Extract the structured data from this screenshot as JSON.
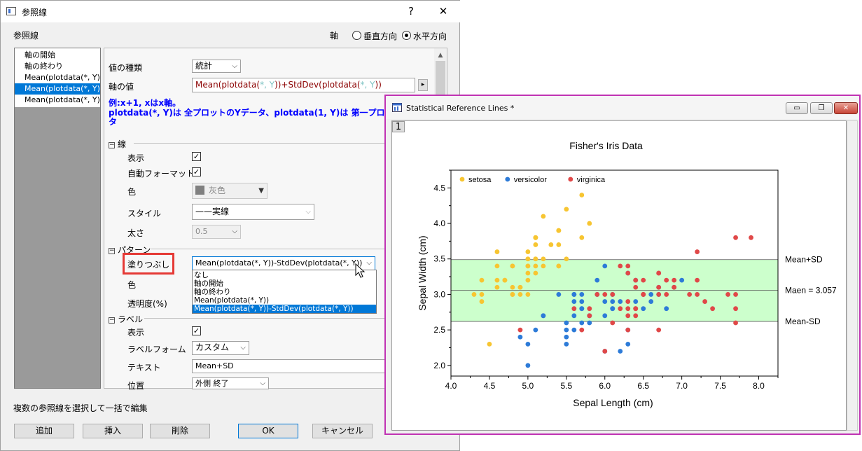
{
  "dialog": {
    "title": "参照線",
    "help_label": "?",
    "close_label": "✕",
    "section_label": "参照線",
    "axis_label": "軸",
    "axis_options": [
      "垂直方向",
      "水平方向"
    ],
    "axis_selected": 1,
    "tree_items": [
      "軸の開始",
      "軸の終わり",
      "Mean(plotdata(*, Y))",
      "Mean(plotdata(*, Y))",
      "Mean(plotdata(*, Y))"
    ],
    "tree_selected": 3,
    "value_type_label": "値の種類",
    "value_type_value": "統計",
    "axis_value_label": "軸の値",
    "axis_value_parts": [
      "Mean(plotdata(",
      "*, Y",
      "))+StdDev(plotdata(",
      "*, Y",
      "))"
    ],
    "expand_button_label": "▸",
    "hint_line1": "例:x+1, xはx軸。",
    "hint_line2": "plotdata(*, Y)は 全プロットのYデータ、plotdata(1, Y)は 第一プロッ",
    "hint_line3": "タ",
    "line_section": {
      "title": "線",
      "show_label": "表示",
      "auto_format_label": "自動フォーマット",
      "color_label": "色",
      "color_value": "灰色",
      "style_label": "スタイル",
      "style_value": "——実線",
      "width_label": "太さ",
      "width_value": "0.5"
    },
    "pattern_section": {
      "title": "パターン",
      "fill_label": "塗りつぶし",
      "fill_value": "Mean(plotdata(*, Y))-StdDev(plotdata(*, Y))",
      "color_label": "色",
      "transparency_label": "透明度(%)",
      "dropdown_options": [
        "なし",
        "軸の開始",
        "軸の終わり",
        "Mean(plotdata(*, Y))",
        "Mean(plotdata(*, Y))-StdDev(plotdata(*, Y))"
      ],
      "dropdown_selected": 4
    },
    "label_section": {
      "title": "ラベル",
      "show_label": "表示",
      "form_label": "ラベルフォーム",
      "form_value": "カスタム",
      "text_label": "テキスト",
      "text_value": "Mean+SD",
      "position_label": "位置",
      "position_value": "外側 終了"
    },
    "bulk_edit_label": "複数の参照線を選択して一括で編集",
    "buttons": {
      "add": "追加",
      "insert": "挿入",
      "delete": "削除",
      "ok": "OK",
      "cancel": "キャンセル"
    },
    "colors": {
      "selection": "#0078d7",
      "highlight_box": "#e53935",
      "hint_text": "#0000ff",
      "formula_text": "#8b0000"
    }
  },
  "graph_window": {
    "title": "Statistical Reference Lines *",
    "page_tab": "1",
    "buttons": [
      "▭",
      "❐",
      "✕"
    ],
    "colors": {
      "border": "#c033b3",
      "band_fill": "#ccffcc",
      "setosa": "#f7c531",
      "versicolor": "#2d7bd8",
      "virginica": "#e04848"
    }
  },
  "chart_data": {
    "type": "scatter",
    "title": "Fisher's Iris Data",
    "xlabel": "Sepal Length (cm)",
    "ylabel": "Sepal Width (cm)",
    "xlim": [
      4.0,
      8.25
    ],
    "ylim": [
      1.85,
      4.75
    ],
    "xticks": [
      "4.0",
      "4.5",
      "5.0",
      "5.5",
      "6.0",
      "6.5",
      "7.0",
      "7.5",
      "8.0"
    ],
    "yticks": [
      "2.0",
      "2.5",
      "3.0",
      "3.5",
      "4.0",
      "4.5"
    ],
    "legend": [
      "setosa",
      "versicolor",
      "virginica"
    ],
    "legend_position": "top-left",
    "grid": false,
    "reference_lines": [
      {
        "label": "Mean+SD",
        "y": 3.49
      },
      {
        "label": "Maen = 3.057",
        "y": 3.057
      },
      {
        "label": "Mean-SD",
        "y": 2.62
      }
    ],
    "band": [
      2.62,
      3.49
    ],
    "series": [
      {
        "name": "setosa",
        "points": [
          [
            5.1,
            3.5
          ],
          [
            4.9,
            3.0
          ],
          [
            4.7,
            3.2
          ],
          [
            4.6,
            3.1
          ],
          [
            5.0,
            3.6
          ],
          [
            5.4,
            3.9
          ],
          [
            4.6,
            3.4
          ],
          [
            5.0,
            3.4
          ],
          [
            4.4,
            2.9
          ],
          [
            4.9,
            3.1
          ],
          [
            5.4,
            3.7
          ],
          [
            4.8,
            3.4
          ],
          [
            4.8,
            3.0
          ],
          [
            4.3,
            3.0
          ],
          [
            5.8,
            4.0
          ],
          [
            5.7,
            4.4
          ],
          [
            5.4,
            3.9
          ],
          [
            5.1,
            3.5
          ],
          [
            5.7,
            3.8
          ],
          [
            5.1,
            3.8
          ],
          [
            5.4,
            3.4
          ],
          [
            5.1,
            3.7
          ],
          [
            4.6,
            3.6
          ],
          [
            5.1,
            3.3
          ],
          [
            4.8,
            3.4
          ],
          [
            5.0,
            3.0
          ],
          [
            5.0,
            3.4
          ],
          [
            5.2,
            3.5
          ],
          [
            5.2,
            3.4
          ],
          [
            4.7,
            3.2
          ],
          [
            4.8,
            3.1
          ],
          [
            5.4,
            3.4
          ],
          [
            5.2,
            4.1
          ],
          [
            5.5,
            4.2
          ],
          [
            4.9,
            3.1
          ],
          [
            5.0,
            3.2
          ],
          [
            5.5,
            3.5
          ],
          [
            4.4,
            3.0
          ],
          [
            5.1,
            3.4
          ],
          [
            5.0,
            3.5
          ],
          [
            4.5,
            2.3
          ],
          [
            4.4,
            3.2
          ],
          [
            5.0,
            3.5
          ],
          [
            5.1,
            3.8
          ],
          [
            4.8,
            3.0
          ],
          [
            5.1,
            3.8
          ],
          [
            4.6,
            3.2
          ],
          [
            5.3,
            3.7
          ],
          [
            5.0,
            3.3
          ]
        ]
      },
      {
        "name": "versicolor",
        "points": [
          [
            7.0,
            3.2
          ],
          [
            6.4,
            3.2
          ],
          [
            6.9,
            3.1
          ],
          [
            5.5,
            2.3
          ],
          [
            6.5,
            2.8
          ],
          [
            5.7,
            2.8
          ],
          [
            6.3,
            3.3
          ],
          [
            4.9,
            2.4
          ],
          [
            6.6,
            2.9
          ],
          [
            5.2,
            2.7
          ],
          [
            5.0,
            2.0
          ],
          [
            5.9,
            3.0
          ],
          [
            6.0,
            2.2
          ],
          [
            6.1,
            2.9
          ],
          [
            5.6,
            2.9
          ],
          [
            6.7,
            3.1
          ],
          [
            5.6,
            3.0
          ],
          [
            5.8,
            2.7
          ],
          [
            6.2,
            2.2
          ],
          [
            5.6,
            2.5
          ],
          [
            5.9,
            3.2
          ],
          [
            6.1,
            2.8
          ],
          [
            6.3,
            2.5
          ],
          [
            6.4,
            2.9
          ],
          [
            6.6,
            3.0
          ],
          [
            6.8,
            2.8
          ],
          [
            6.7,
            3.0
          ],
          [
            6.0,
            2.9
          ],
          [
            5.7,
            2.6
          ],
          [
            5.5,
            2.4
          ],
          [
            5.8,
            2.7
          ],
          [
            6.0,
            2.7
          ],
          [
            5.4,
            3.0
          ],
          [
            6.0,
            3.4
          ],
          [
            6.3,
            2.3
          ],
          [
            5.6,
            3.0
          ],
          [
            5.5,
            2.5
          ],
          [
            5.5,
            2.6
          ],
          [
            6.1,
            3.0
          ],
          [
            5.8,
            2.6
          ],
          [
            5.0,
            2.3
          ],
          [
            5.6,
            2.7
          ],
          [
            5.7,
            3.0
          ],
          [
            5.7,
            2.9
          ],
          [
            6.2,
            2.9
          ],
          [
            5.1,
            2.5
          ],
          [
            5.7,
            2.8
          ],
          [
            5.2,
            2.7
          ],
          [
            6.1,
            2.8
          ]
        ]
      },
      {
        "name": "virginica",
        "points": [
          [
            6.3,
            3.3
          ],
          [
            5.8,
            2.7
          ],
          [
            7.1,
            3.0
          ],
          [
            6.3,
            2.9
          ],
          [
            6.5,
            3.0
          ],
          [
            7.6,
            3.0
          ],
          [
            4.9,
            2.5
          ],
          [
            7.3,
            2.9
          ],
          [
            6.7,
            2.5
          ],
          [
            7.2,
            3.6
          ],
          [
            6.5,
            3.2
          ],
          [
            6.4,
            2.7
          ],
          [
            6.8,
            3.0
          ],
          [
            5.7,
            2.5
          ],
          [
            5.8,
            2.8
          ],
          [
            6.4,
            3.2
          ],
          [
            6.5,
            3.0
          ],
          [
            7.7,
            3.8
          ],
          [
            7.7,
            2.6
          ],
          [
            6.0,
            2.2
          ],
          [
            6.9,
            3.2
          ],
          [
            5.6,
            2.8
          ],
          [
            7.7,
            2.8
          ],
          [
            6.3,
            2.7
          ],
          [
            6.7,
            3.3
          ],
          [
            7.2,
            3.2
          ],
          [
            6.2,
            2.8
          ],
          [
            6.1,
            3.0
          ],
          [
            6.4,
            2.8
          ],
          [
            7.2,
            3.0
          ],
          [
            7.4,
            2.8
          ],
          [
            7.9,
            3.8
          ],
          [
            6.4,
            2.8
          ],
          [
            6.3,
            2.8
          ],
          [
            6.1,
            2.6
          ],
          [
            7.7,
            3.0
          ],
          [
            6.3,
            3.4
          ],
          [
            6.4,
            3.1
          ],
          [
            6.0,
            3.0
          ],
          [
            6.9,
            3.1
          ],
          [
            6.7,
            3.1
          ],
          [
            6.9,
            3.1
          ],
          [
            6.8,
            3.2
          ],
          [
            6.7,
            3.3
          ],
          [
            6.7,
            3.0
          ],
          [
            6.3,
            2.5
          ],
          [
            6.5,
            3.0
          ],
          [
            6.2,
            3.4
          ],
          [
            5.9,
            3.0
          ]
        ]
      }
    ]
  }
}
